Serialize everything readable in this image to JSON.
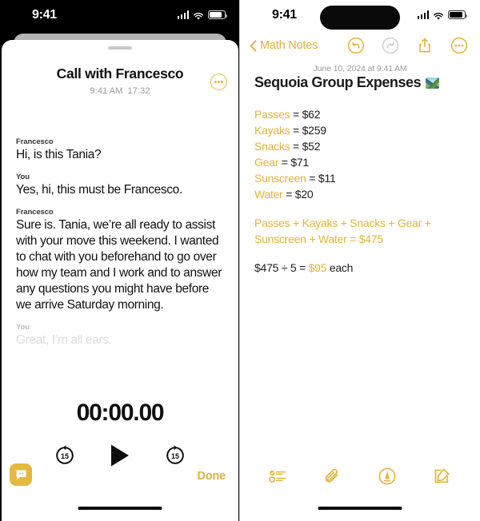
{
  "left_phone": {
    "status_bar": {
      "time": "9:41",
      "cellular": "signal-bars",
      "wifi": "wifi",
      "battery": "battery"
    },
    "sheet": {
      "title": "Call with Francesco",
      "time_label": "9:41 AM",
      "duration_label": "17:32",
      "more_icon": "ellipsis-circle-icon",
      "transcript": [
        {
          "speaker": "Francesco",
          "text": "Hi, is this Tania?",
          "faded": false
        },
        {
          "speaker": "You",
          "text": "Yes, hi, this must be Francesco.",
          "faded": false
        },
        {
          "speaker": "Francesco",
          "text": "Sure is. Tania, we’re all ready to assist with your move this weekend. I wanted to chat with you beforehand to go over how my team and I work and to answer any questions you might have before we arrive Saturday morning.",
          "faded": false
        },
        {
          "speaker": "You",
          "text": "Great, I’m all ears.",
          "faded": true
        }
      ],
      "timer": "00:00.00",
      "controls": {
        "rewind_label": "15",
        "rewind_icon": "skip-back-15-icon",
        "play_icon": "play-icon",
        "forward_label": "15",
        "forward_icon": "skip-forward-15-icon"
      },
      "transcript_toggle_icon": "transcript-bubble-icon",
      "done_label": "Done"
    }
  },
  "right_phone": {
    "status_bar": {
      "time": "9:41",
      "cellular": "signal-bars",
      "wifi": "wifi",
      "battery": "battery"
    },
    "nav": {
      "back_icon": "chevron-left-icon",
      "back_label": "Math Notes",
      "undo_icon": "undo-icon",
      "redo_icon": "redo-icon",
      "share_icon": "share-icon",
      "more_icon": "ellipsis-circle-icon"
    },
    "note": {
      "date": "June 10, 2024 at 9:41 AM",
      "title": "Sequoia Group Expenses",
      "title_emoji": "national-park-emoji",
      "lines": [
        {
          "tokens": [
            {
              "t": "Passes",
              "c": "y"
            },
            {
              "t": " = ",
              "c": "d"
            },
            {
              "t": "$62",
              "c": "d"
            }
          ]
        },
        {
          "tokens": [
            {
              "t": "Kayaks",
              "c": "y"
            },
            {
              "t": " = ",
              "c": "d"
            },
            {
              "t": "$259",
              "c": "d"
            }
          ]
        },
        {
          "tokens": [
            {
              "t": "Snacks",
              "c": "y"
            },
            {
              "t": " = ",
              "c": "d"
            },
            {
              "t": "$52",
              "c": "d"
            }
          ]
        },
        {
          "tokens": [
            {
              "t": "Gear",
              "c": "y"
            },
            {
              "t": " = ",
              "c": "d"
            },
            {
              "t": "$71",
              "c": "d"
            }
          ]
        },
        {
          "tokens": [
            {
              "t": "Sunscreen",
              "c": "y"
            },
            {
              "t": " = ",
              "c": "d"
            },
            {
              "t": "$11",
              "c": "d"
            }
          ]
        },
        {
          "tokens": [
            {
              "t": "Water",
              "c": "y"
            },
            {
              "t": " = ",
              "c": "d"
            },
            {
              "t": "$20",
              "c": "d"
            }
          ]
        },
        {
          "spacer": true
        },
        {
          "tokens": [
            {
              "t": "Passes",
              "c": "y"
            },
            {
              "t": " + ",
              "c": "y"
            },
            {
              "t": "Kayaks",
              "c": "y"
            },
            {
              "t": " + ",
              "c": "y"
            },
            {
              "t": "Snacks",
              "c": "y"
            },
            {
              "t": " + ",
              "c": "y"
            },
            {
              "t": "Gear",
              "c": "y"
            },
            {
              "t": " +",
              "c": "y"
            }
          ]
        },
        {
          "tokens": [
            {
              "t": "Sunscreen",
              "c": "y"
            },
            {
              "t": " + ",
              "c": "y"
            },
            {
              "t": "Water",
              "c": "y"
            },
            {
              "t": " = ",
              "c": "y"
            },
            {
              "t": "$475",
              "c": "y"
            }
          ]
        },
        {
          "spacer": true
        },
        {
          "tokens": [
            {
              "t": "$475 ÷ 5 = ",
              "c": "d"
            },
            {
              "t": "$95",
              "c": "y"
            },
            {
              "t": " each",
              "c": "d"
            }
          ]
        }
      ]
    },
    "toolbar": {
      "checklist_icon": "checklist-icon",
      "attachment_icon": "paperclip-icon",
      "markup_icon": "markup-pen-icon",
      "compose_icon": "compose-icon"
    }
  },
  "colors": {
    "accent_yellow": "#E3B33C",
    "accent_yellow_soft": "#DDB03C",
    "text_primary": "#1C1C1C",
    "text_muted": "#9B9B9B",
    "faded_text": "#DCDCDC",
    "sheet_back": "#B4B4B4",
    "divider": "#D8D8D8"
  }
}
